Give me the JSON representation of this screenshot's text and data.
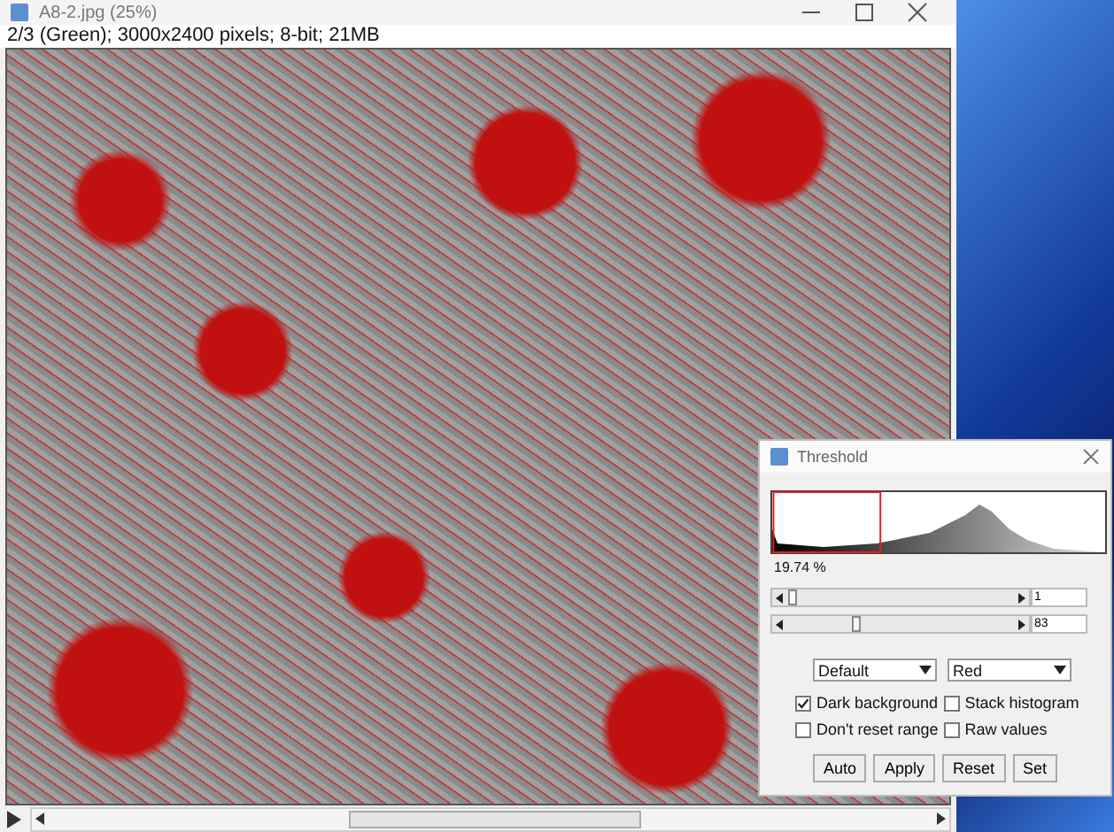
{
  "window": {
    "title": "A8-2.jpg (25%)"
  },
  "info": "2/3 (Green); 3000x2400 pixels; 8-bit; 21MB",
  "threshold_dialog": {
    "title": "Threshold",
    "percent": "19.74 %",
    "sliders": [
      {
        "level": 0.004,
        "value": "1"
      },
      {
        "level": 0.325,
        "value": "83"
      }
    ],
    "dropdowns": [
      "Default",
      "Red"
    ],
    "checkboxes": [
      {
        "label": "Dark background",
        "checked": true
      },
      {
        "label": "Stack histogram",
        "checked": false
      },
      {
        "label": "Don't reset range",
        "checked": false
      },
      {
        "label": "Raw values",
        "checked": false
      }
    ],
    "buttons": [
      "Auto",
      "Apply",
      "Reset",
      "Set"
    ]
  }
}
